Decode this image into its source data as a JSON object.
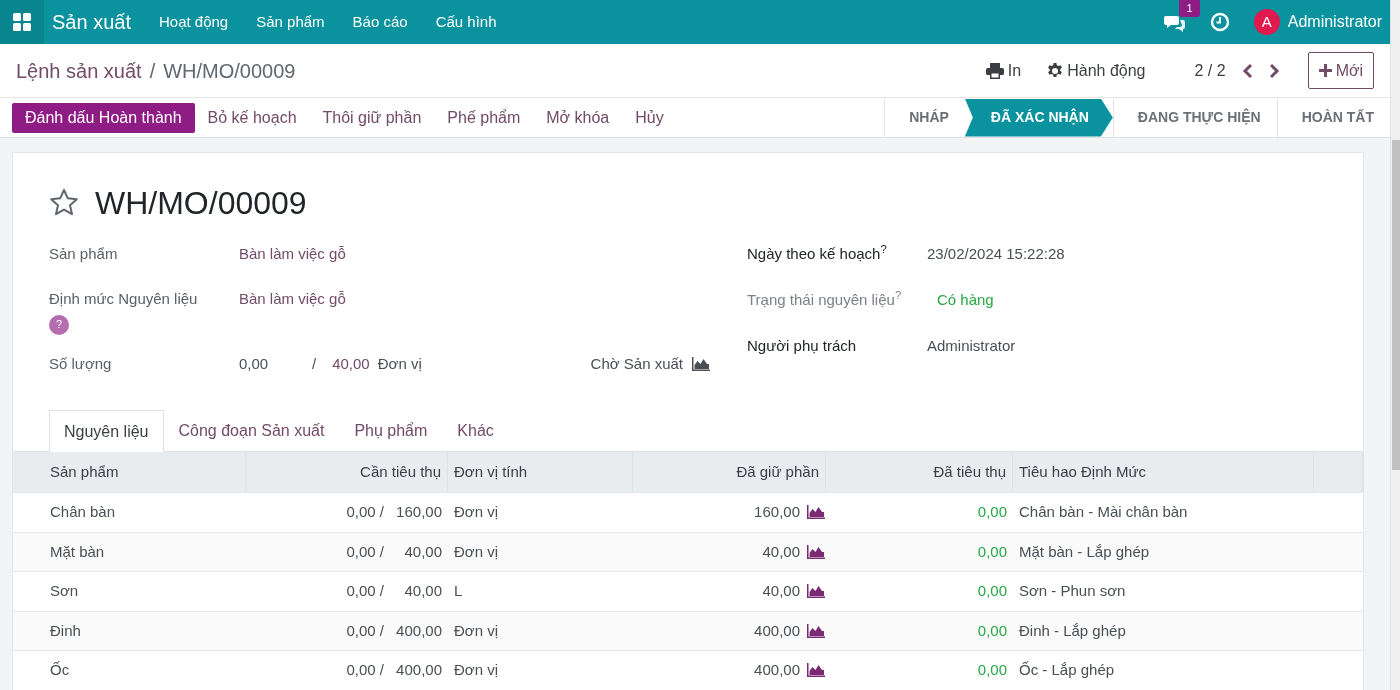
{
  "navbar": {
    "app": "Sản xuất",
    "menu": [
      "Hoạt động",
      "Sản phẩm",
      "Báo cáo",
      "Cấu hình"
    ],
    "notifications": "1",
    "user_initial": "A",
    "user": "Administrator"
  },
  "breadcrumb": {
    "parent": "Lệnh sản xuất",
    "separator": "/",
    "current": "WH/MO/00009"
  },
  "toolbar": {
    "print": "In",
    "action": "Hành động",
    "pager": "2 / 2",
    "new": "Mới"
  },
  "actions": [
    {
      "label": "Đánh dấu Hoàn thành",
      "primary": true
    },
    {
      "label": "Bỏ kế hoạch",
      "primary": false
    },
    {
      "label": "Thôi giữ phần",
      "primary": false
    },
    {
      "label": "Phế phẩm",
      "primary": false
    },
    {
      "label": "Mở khóa",
      "primary": false
    },
    {
      "label": "Hủy",
      "primary": false
    }
  ],
  "stages": [
    {
      "label": "NHÁP",
      "selected": false
    },
    {
      "label": "ĐÃ XÁC NHẬN",
      "selected": true
    },
    {
      "label": "ĐANG THỰC HIỆN",
      "selected": false
    },
    {
      "label": "HOÀN TẤT",
      "selected": false
    }
  ],
  "record": {
    "title": "WH/MO/00009",
    "starred": false,
    "left_fields": [
      {
        "label": "Sản phẩm",
        "kind": "link",
        "value": "Bàn làm việc gỗ"
      },
      {
        "label": "Định mức Nguyên liệu",
        "help": "?",
        "kind": "link",
        "value": "Bàn làm việc gỗ"
      }
    ],
    "quantity": {
      "label": "Số lượng",
      "produced": "0,00",
      "separator": "/",
      "planned": "40,00",
      "uom": "Đơn vị",
      "status": "Chờ Sản xuất"
    },
    "right_fields": [
      {
        "label": "Ngày theo kế hoạch$^{?}$",
        "muted": false,
        "kind": "plain",
        "value": "23/02/2024 15:22:28"
      },
      {
        "label": "Trạng thái nguyên liệu$^{?}$",
        "muted": true,
        "kind": "status",
        "value": "Có hàng"
      },
      {
        "label": "Người phụ trách",
        "muted": false,
        "kind": "plain",
        "value": "Administrator"
      }
    ]
  },
  "tabs": [
    {
      "label": "Nguyên liệu",
      "selected": true
    },
    {
      "label": "Công đoạn Sản xuất",
      "selected": false
    },
    {
      "label": "Phụ phẩm",
      "selected": false
    },
    {
      "label": "Khác",
      "selected": false
    }
  ],
  "table": {
    "columns": [
      {
        "label": "Sản phẩm",
        "kind": "text"
      },
      {
        "label": "Cần tiêu thụ",
        "kind": "number"
      },
      {
        "label": "Đơn vị tính",
        "kind": "text"
      },
      {
        "label": "Đã giữ phần",
        "kind": "number"
      },
      {
        "label": "Đã tiêu thụ",
        "kind": "number"
      },
      {
        "label": "Tiêu hao Định Mức",
        "kind": "text"
      }
    ],
    "rows": [
      {
        "product": "Chân bàn",
        "consumed": "0,00 /",
        "to_consume": "160,00",
        "uom": "Đơn vị",
        "reserved": "160,00",
        "done": "0,00",
        "operation": "Chân bàn - Mài chân bàn"
      },
      {
        "product": "Mặt bàn",
        "consumed": "0,00 /",
        "to_consume": "40,00",
        "uom": "Đơn vị",
        "reserved": "40,00",
        "done": "0,00",
        "operation": "Mặt bàn - Lắp ghép"
      },
      {
        "product": "Sơn",
        "consumed": "0,00 /",
        "to_consume": "40,00",
        "uom": "L",
        "reserved": "40,00",
        "done": "0,00",
        "operation": "Sơn - Phun sơn"
      },
      {
        "product": "Đinh",
        "consumed": "0,00 /",
        "to_consume": "400,00",
        "uom": "Đơn vị",
        "reserved": "400,00",
        "done": "0,00",
        "operation": "Đinh - Lắp ghép"
      },
      {
        "product": "Ốc",
        "consumed": "0,00 /",
        "to_consume": "400,00",
        "uom": "Đơn vị",
        "reserved": "400,00",
        "done": "0,00",
        "operation": "Ốc - Lắp ghép"
      }
    ]
  }
}
